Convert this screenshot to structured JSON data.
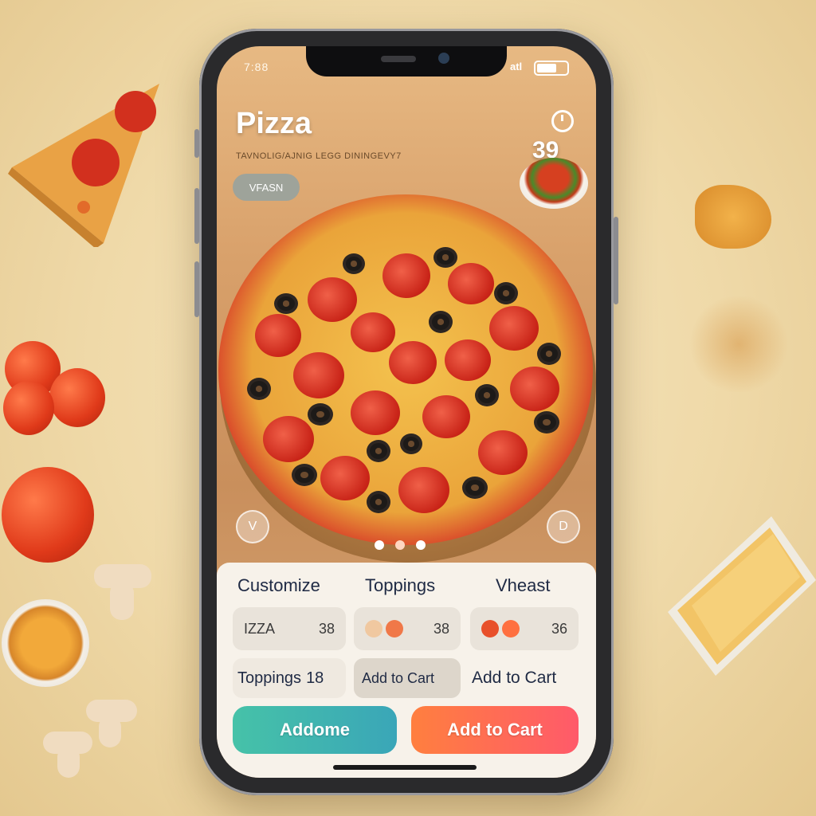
{
  "status_bar": {
    "time": "7:88",
    "signal": "atl",
    "battery_level": 0.75
  },
  "header": {
    "title": "Pizza",
    "subtitle": "TAVNOLIG/AJNIG LEGG DININGEVY7",
    "pill_label": "VFASN",
    "count": "39"
  },
  "carousel": {
    "prev_label": "V",
    "next_label": "D",
    "dot_count": 3,
    "active_dot": 1
  },
  "panel": {
    "columns": [
      "Customize",
      "Toppings",
      "Vheast"
    ],
    "chips": [
      {
        "label": "IZZA",
        "value": "38"
      },
      {
        "label": "",
        "value": "38"
      },
      {
        "label": "",
        "value": "36"
      }
    ],
    "row2": [
      "Toppings",
      "Add to Cart",
      "Add to Cart"
    ],
    "row2_value": "18",
    "buttons": {
      "primary": "Addome",
      "secondary": "Add to Cart"
    }
  },
  "colors": {
    "primary_button": "#3cb8b0",
    "secondary_button": "#ff6a3d",
    "accent_text": "#1f2a44"
  }
}
